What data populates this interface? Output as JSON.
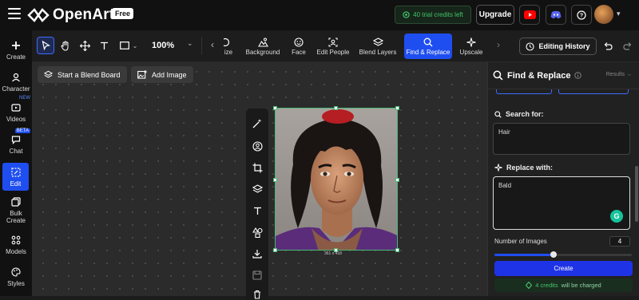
{
  "header": {
    "app_name": "OpenArt",
    "plan_badge": "Free",
    "credits_text": "40 trial credits left",
    "upgrade_label": "Upgrade",
    "icons": [
      "menu-icon",
      "youtube-icon",
      "discord-icon",
      "help-icon",
      "avatar"
    ]
  },
  "sidebar": {
    "items": [
      {
        "label": "Create",
        "icon": "plus-icon"
      },
      {
        "label": "Character",
        "icon": "user-icon"
      },
      {
        "label": "Videos",
        "icon": "video-icon",
        "badge": "NEW"
      },
      {
        "label": "Chat",
        "icon": "chat-icon",
        "badge": "BETA"
      },
      {
        "label": "Edit",
        "icon": "edit-icon",
        "active": true
      },
      {
        "label": "Bulk Create",
        "icon": "copy-icon"
      },
      {
        "label": "Models",
        "icon": "grid-icon"
      },
      {
        "label": "Styles",
        "icon": "palette-icon"
      }
    ]
  },
  "toolbar": {
    "zoom": "100%",
    "features": [
      {
        "label": "ize",
        "icon": "resize-icon"
      },
      {
        "label": "Background",
        "icon": "background-icon"
      },
      {
        "label": "Face",
        "icon": "face-icon"
      },
      {
        "label": "Edit People",
        "icon": "people-icon"
      },
      {
        "label": "Blend Layers",
        "icon": "layers-icon"
      },
      {
        "label": "Find & Replace",
        "icon": "search-icon",
        "active": true
      },
      {
        "label": "Upscale",
        "icon": "sparkle-icon"
      }
    ],
    "editing_history_label": "Editing History"
  },
  "canvas": {
    "blend_board_label": "Start a Blend Board",
    "add_image_label": "Add Image",
    "image_dimensions": "361 x 418"
  },
  "panel": {
    "title": "Find & Replace",
    "results_label": "Results",
    "search_label": "Search for:",
    "search_value": "Hair",
    "replace_label": "Replace with:",
    "replace_value": "Bald",
    "num_images_label": "Number of Images",
    "num_images_value": "4",
    "slider_fraction": 0.43,
    "create_label": "Create",
    "charge_credits": "4 credits",
    "charge_suffix": "will be charged"
  },
  "colors": {
    "accent": "#1f4ef0",
    "success": "#44c46a",
    "selection": "#4bb878"
  }
}
